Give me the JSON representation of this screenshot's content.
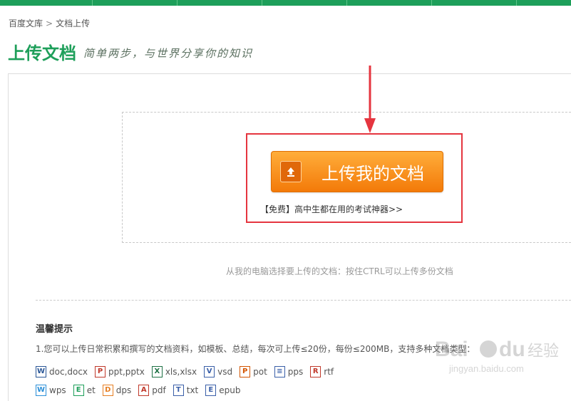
{
  "breadcrumb": {
    "home": "百度文库",
    "separator": ">",
    "current": "文档上传"
  },
  "page": {
    "title": "上传文档",
    "slogan": "简单两步，与世界分享你的知识"
  },
  "upload": {
    "button_label": "上传我的文档",
    "promo": "【免费】高中生都在用的考试神器>>",
    "hint": "从我的电脑选择要上传的文档：按住CTRL可以上传多份文档"
  },
  "tips": {
    "title": "温馨提示",
    "line1": "1.您可以上传日常积累和撰写的文档资料，如模板、总结，每次可上传≤20份，每份≤200MB，支持多种文档类型："
  },
  "file_types": [
    {
      "label": "doc,docx",
      "icon": "W",
      "color": "#2b5797"
    },
    {
      "label": "ppt,pptx",
      "icon": "P",
      "color": "#c0392b"
    },
    {
      "label": "xls,xlsx",
      "icon": "X",
      "color": "#1e7145"
    },
    {
      "label": "vsd",
      "icon": "V",
      "color": "#3a5fa8"
    },
    {
      "label": "pot",
      "icon": "P",
      "color": "#d35400"
    },
    {
      "label": "pps",
      "icon": "≡",
      "color": "#3a5fa8"
    },
    {
      "label": "rtf",
      "icon": "R",
      "color": "#c0392b"
    }
  ],
  "file_types2": [
    {
      "label": "wps",
      "icon": "W",
      "color": "#2b8fd8"
    },
    {
      "label": "et",
      "icon": "E",
      "color": "#1e9f5a"
    },
    {
      "label": "dps",
      "icon": "D",
      "color": "#e67e22"
    },
    {
      "label": "pdf",
      "icon": "A",
      "color": "#c0392b"
    },
    {
      "label": "txt",
      "icon": "T",
      "color": "#3a5fa8"
    },
    {
      "label": "epub",
      "icon": "E",
      "color": "#3a5fa8"
    }
  ],
  "watermark": {
    "brand": "Bai",
    "brand2": "du",
    "sub": "经验",
    "url": "jingyan.baidu.com"
  },
  "colors": {
    "brand_green": "#1e9f5a",
    "accent_orange": "#f37a09",
    "highlight_red": "#e5353f"
  }
}
